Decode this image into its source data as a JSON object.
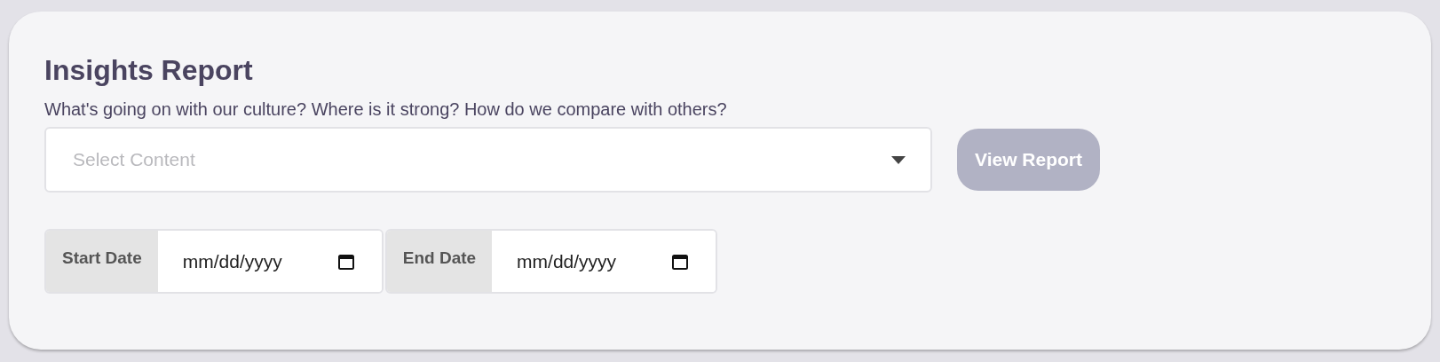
{
  "title": "Insights Report",
  "subtitle": "What's going on with our culture? Where is it strong? How do we compare with others?",
  "select": {
    "placeholder": "Select Content"
  },
  "view_button": {
    "label": "View Report",
    "disabled": true
  },
  "dates": [
    {
      "label": "Start Date",
      "placeholder": "mm/dd/yyyy"
    },
    {
      "label": "End Date",
      "placeholder": "mm/dd/yyyy"
    }
  ]
}
